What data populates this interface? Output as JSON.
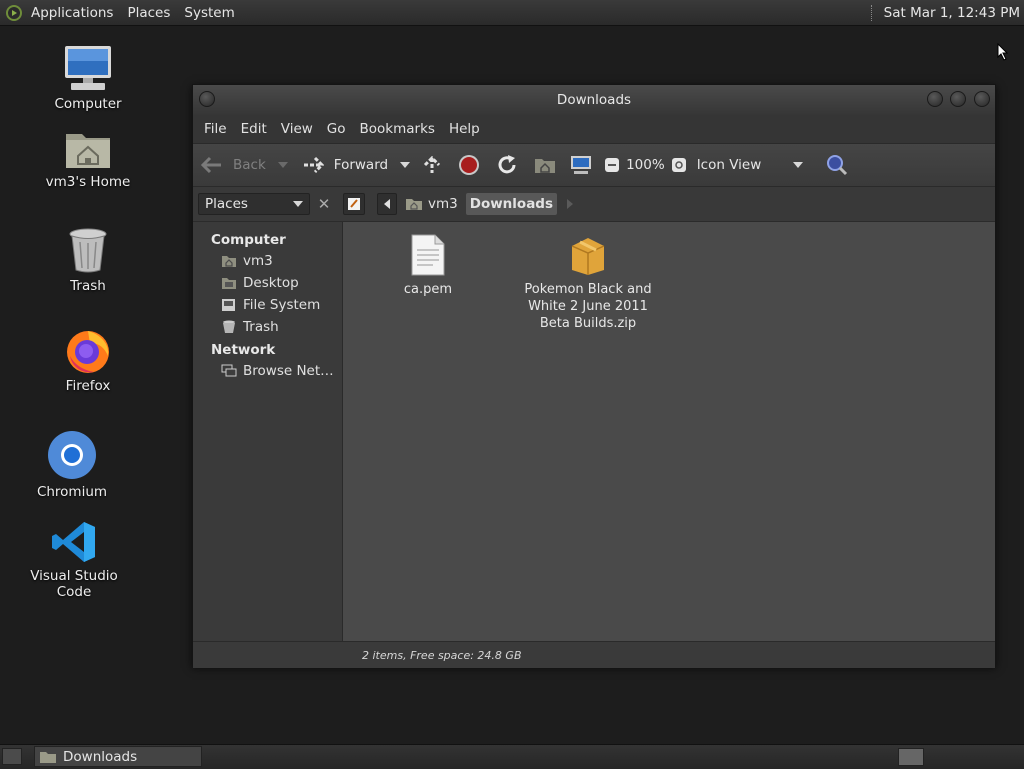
{
  "top_panel": {
    "menu": [
      "Applications",
      "Places",
      "System"
    ],
    "clock": "Sat Mar  1, 12:43 PM"
  },
  "desktop_icons": [
    {
      "label": "Computer",
      "icon": "computer-icon"
    },
    {
      "label": "vm3's Home",
      "icon": "home-folder-icon"
    },
    {
      "label": "Trash",
      "icon": "trash-icon"
    },
    {
      "label": "Firefox",
      "icon": "firefox-icon"
    },
    {
      "label": "Chromium",
      "icon": "chromium-icon"
    },
    {
      "label": "Visual Studio Code",
      "icon": "vscode-icon"
    }
  ],
  "window": {
    "title": "Downloads",
    "menu": [
      "File",
      "Edit",
      "View",
      "Go",
      "Bookmarks",
      "Help"
    ],
    "toolbar": {
      "back": "Back",
      "forward": "Forward",
      "zoom": "100%",
      "view_mode": "Icon View"
    },
    "location": {
      "places_label": "Places",
      "crumbs": [
        "vm3",
        "Downloads"
      ]
    },
    "sidebar": {
      "sections": [
        {
          "title": "Computer",
          "items": [
            "vm3",
            "Desktop",
            "File System",
            "Trash"
          ]
        },
        {
          "title": "Network",
          "items": [
            "Browse Net…"
          ]
        }
      ]
    },
    "files": [
      {
        "name": "ca.pem",
        "icon": "text-file-icon"
      },
      {
        "name": "Pokemon Black and White 2 June 2011 Beta Builds.zip",
        "icon": "archive-icon"
      }
    ],
    "status": "2 items, Free space: 24.8 GB"
  },
  "bottom_panel": {
    "task_label": "Downloads"
  }
}
